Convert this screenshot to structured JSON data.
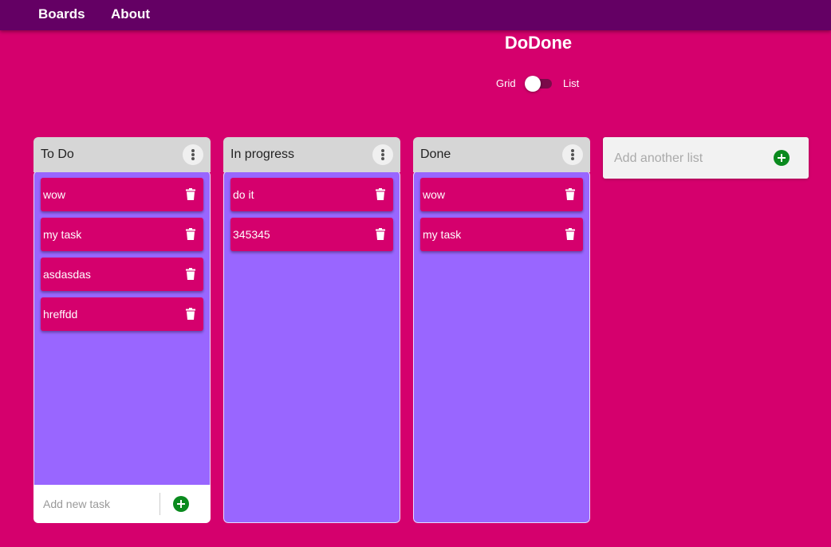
{
  "nav": {
    "boards": "Boards",
    "about": "About"
  },
  "app_title": "DoDone",
  "view_toggle": {
    "left_label": "Grid",
    "right_label": "List",
    "state": "Grid"
  },
  "lists": [
    {
      "title": "To Do",
      "tasks": [
        "wow",
        "my task",
        "asdasdas",
        "hreffdd"
      ],
      "has_add_task": true
    },
    {
      "title": "In progress",
      "tasks": [
        "do it",
        "345345"
      ],
      "has_add_task": false
    },
    {
      "title": "Done",
      "tasks": [
        "wow",
        "my task"
      ],
      "has_add_task": false
    }
  ],
  "add_task": {
    "placeholder": "Add new task"
  },
  "add_list": {
    "placeholder": "Add another list"
  },
  "icons": {
    "menu": "vertical-dots-icon",
    "delete": "trash-icon",
    "add": "plus-circle-icon"
  },
  "colors": {
    "background": "#d5006d",
    "navbar": "#640064",
    "list_body": "#9966ff",
    "task_card": "#d5006d",
    "add_button": "#0a8a1e"
  }
}
